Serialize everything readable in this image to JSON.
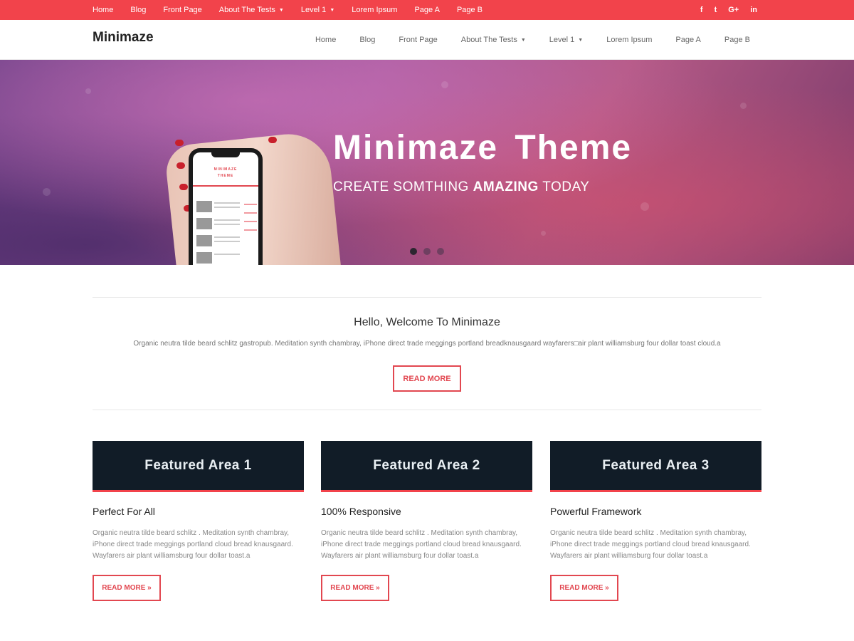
{
  "topbar": {
    "nav": [
      {
        "label": "Home"
      },
      {
        "label": "Blog"
      },
      {
        "label": "Front Page"
      },
      {
        "label": "About The Tests",
        "dropdown": true
      },
      {
        "label": "Level 1",
        "dropdown": true
      },
      {
        "label": "Lorem Ipsum"
      },
      {
        "label": "Page A"
      },
      {
        "label": "Page B"
      }
    ],
    "social": [
      "f",
      "t",
      "G+",
      "in"
    ],
    "social_icons": [
      "facebook-icon",
      "twitter-icon",
      "google-plus-icon",
      "linkedin-icon"
    ],
    "color": "#f2434b"
  },
  "header": {
    "logo": "Minimaze",
    "nav": [
      {
        "label": "Home"
      },
      {
        "label": "Blog"
      },
      {
        "label": "Front Page"
      },
      {
        "label": "About The Tests",
        "dropdown": true
      },
      {
        "label": "Level 1",
        "dropdown": true
      },
      {
        "label": "Lorem Ipsum"
      },
      {
        "label": "Page A"
      },
      {
        "label": "Page B"
      }
    ]
  },
  "hero": {
    "title": "Minimaze Theme",
    "subtitle_pre": "CREATE SOMTHING ",
    "subtitle_bold": "AMAZING",
    "subtitle_post": " TODAY",
    "phone_title_1": "MINIMAZE",
    "phone_title_2": "THEME",
    "slides": 3,
    "active_slide": 1
  },
  "welcome": {
    "title": "Hello, Welcome To Minimaze",
    "text": "Organic neutra tilde beard schlitz gastropub. Meditation synth chambray, iPhone direct trade meggings portland breadknausgaard wayfarers□air plant williamsburg four dollar toast cloud.a",
    "button": "READ MORE"
  },
  "featured": [
    {
      "banner": "Featured Area 1",
      "title": "Perfect For All",
      "desc": "Organic neutra tilde beard schlitz . Meditation synth chambray, iPhone direct trade meggings portland cloud bread knausgaard. Wayfarers air plant williamsburg four dollar toast.a",
      "button": "READ MORE »"
    },
    {
      "banner": "Featured Area 2",
      "title": "100% Responsive",
      "desc": "Organic neutra tilde beard schlitz . Meditation synth chambray, iPhone direct trade meggings portland cloud bread knausgaard. Wayfarers air plant williamsburg four dollar toast.a",
      "button": "READ MORE »"
    },
    {
      "banner": "Featured Area 3",
      "title": "Powerful Framework",
      "desc": "Organic neutra tilde beard schlitz . Meditation synth chambray, iPhone direct trade meggings portland cloud bread knausgaard. Wayfarers air plant williamsburg four dollar toast.a",
      "button": "READ MORE »"
    }
  ],
  "colors": {
    "accent": "#f2434b",
    "dark": "#111c27"
  }
}
